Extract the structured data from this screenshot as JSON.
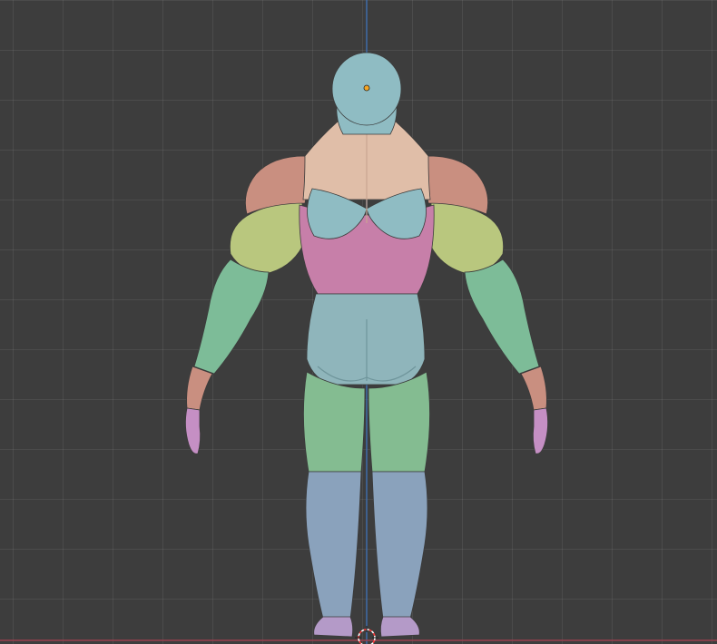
{
  "viewport": {
    "background_color": "#3d3d3d",
    "grid_color": "#4a4a4a",
    "z_axis_color": "#3e6fb0",
    "x_axis_color": "#9c3e4e",
    "origin_point_color": "#f5a623",
    "cursor_color": "#ff3a3a"
  },
  "model": {
    "view": "back",
    "segment_colors": {
      "head": "#8fbcc3",
      "upper_back": "#e0bea8",
      "shoulders": "#c98f80",
      "upper_arms": "#b9c77e",
      "forearms": "#7dbc98",
      "wrists": "#c98f80",
      "hands": "#c58fc4",
      "lower_back": "#c77fa9",
      "shoulder_blades": "#8fbcc3",
      "pelvis": "#8fb5bb",
      "thighs": "#84bc91",
      "shins": "#8aa2bc",
      "feet": "#b49ac8"
    }
  }
}
